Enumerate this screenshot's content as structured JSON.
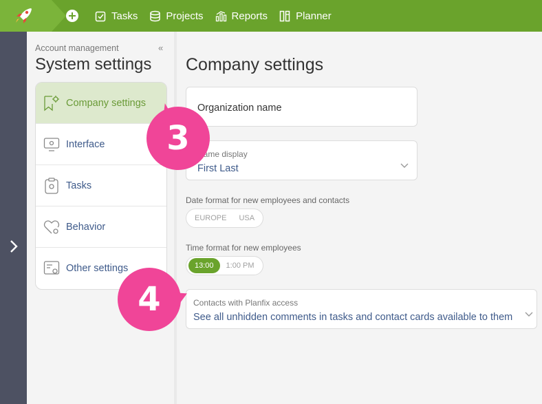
{
  "topbar": {
    "nav": [
      {
        "label": "Tasks",
        "icon": "checkbox-icon"
      },
      {
        "label": "Projects",
        "icon": "database-icon"
      },
      {
        "label": "Reports",
        "icon": "bar-chart-icon"
      },
      {
        "label": "Planner",
        "icon": "planner-icon"
      }
    ]
  },
  "sidebar": {
    "breadcrumb": "Account management",
    "collapse": "«",
    "title": "System settings",
    "items": [
      {
        "label": "Company settings",
        "icon": "company-gear-icon",
        "active": true
      },
      {
        "label": "Interface",
        "icon": "monitor-gear-icon"
      },
      {
        "label": "Tasks",
        "icon": "clipboard-gear-icon"
      },
      {
        "label": "Behavior",
        "icon": "heart-gear-icon"
      },
      {
        "label": "Other settings",
        "icon": "doc-gear-icon"
      }
    ]
  },
  "main": {
    "title": "Company settings",
    "org_name_label": "Organization name",
    "name_display": {
      "label": "Name display",
      "value": "First Last"
    },
    "date_format": {
      "label": "Date format for new employees and contacts",
      "options": [
        "EUROPE",
        "USA"
      ]
    },
    "time_format": {
      "label": "Time format for new employees",
      "options": [
        "13:00",
        "1:00 PM"
      ],
      "selected": "13:00"
    },
    "contacts": {
      "label": "Contacts with Planfix access",
      "value": "See all unhidden comments in tasks and contact cards available to them"
    }
  },
  "markers": [
    "3",
    "4"
  ],
  "colors": {
    "brand_green": "#6aa32c",
    "marker_pink": "#f04598",
    "rail": "#4d5162",
    "link_blue": "#3e5a8a"
  }
}
